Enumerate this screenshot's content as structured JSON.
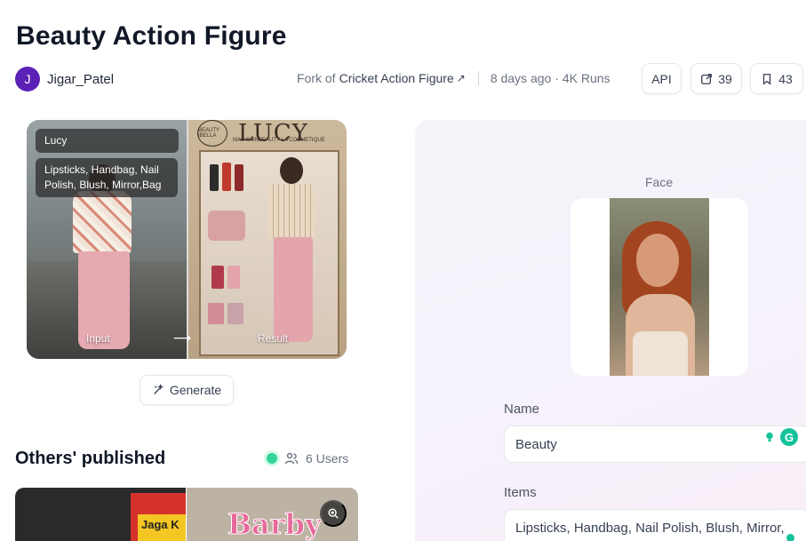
{
  "page": {
    "title": "Beauty Action Figure"
  },
  "author": {
    "initial": "J",
    "name": "Jigar_Patel",
    "avatar_color": "#5b21b6"
  },
  "meta": {
    "fork_prefix": "Fork of",
    "fork_name": "Cricket Action Figure",
    "fork_arrow": "↗",
    "age": "8 days ago",
    "runs": "· 4K Runs"
  },
  "actions": {
    "api_label": "API",
    "fork_count": "39",
    "save_count": "43"
  },
  "preview": {
    "name_badge": "Lucy",
    "items_badge": "Lipsticks, Handbag, Nail Polish, Blush, Mirror,Bag",
    "input_label": "Input",
    "result_label": "Result",
    "arrow": "⟶",
    "box_brand": "LUCY",
    "box_subtitle": "MAC SKINBEAUTY LA COSMETIQUE",
    "seal_text": "BEAUTY IBELLA"
  },
  "generate": {
    "label": "Generate"
  },
  "others": {
    "title": "Others' published",
    "users": "6 Users",
    "thumb1_sign": "Jaga K",
    "thumb2_text": "Barby"
  },
  "form": {
    "face_label": "Face",
    "name_label": "Name",
    "name_value": "Beauty",
    "items_label": "Items",
    "items_value": "Lipsticks, Handbag, Nail Polish, Blush, Mirror, Bag"
  },
  "colors": {
    "accent_green": "#15c39a",
    "live_dot": "#34d399"
  }
}
